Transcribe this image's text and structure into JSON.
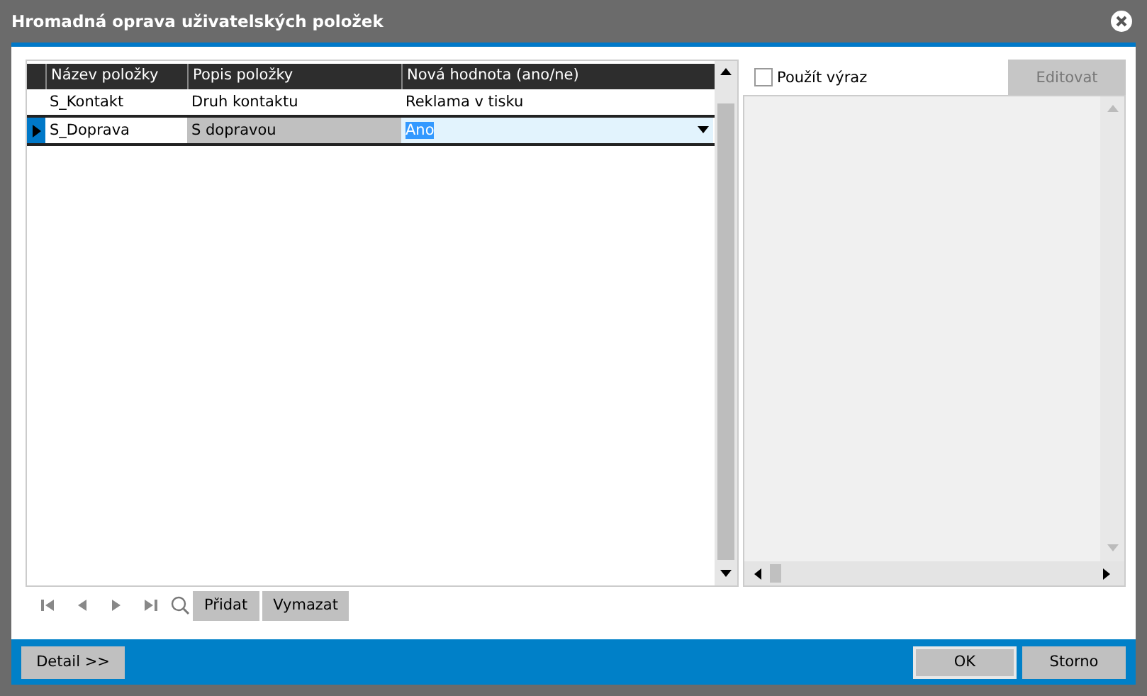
{
  "window": {
    "title": "Hromadná oprava uživatelských položek"
  },
  "table": {
    "columns": [
      "Název položky",
      "Popis položky",
      "Nová hodnota (ano/ne)"
    ],
    "rows": [
      {
        "name": "S_Kontakt",
        "description": "Druh kontaktu",
        "value": "Reklama v tisku",
        "selected": false
      },
      {
        "name": "S_Doprava",
        "description": "S dopravou",
        "value": "Ano",
        "selected": true
      }
    ]
  },
  "navigator": {
    "buttons": [
      "Přidat",
      "Vymazat"
    ]
  },
  "expression": {
    "checkbox": {
      "label": "Použít výraz",
      "checked": false
    },
    "edit_button": {
      "label": "Editovat",
      "disabled": true
    }
  },
  "footer": {
    "detail_button": "Detail >>",
    "ok_button": "OK",
    "cancel_button": "Storno"
  }
}
